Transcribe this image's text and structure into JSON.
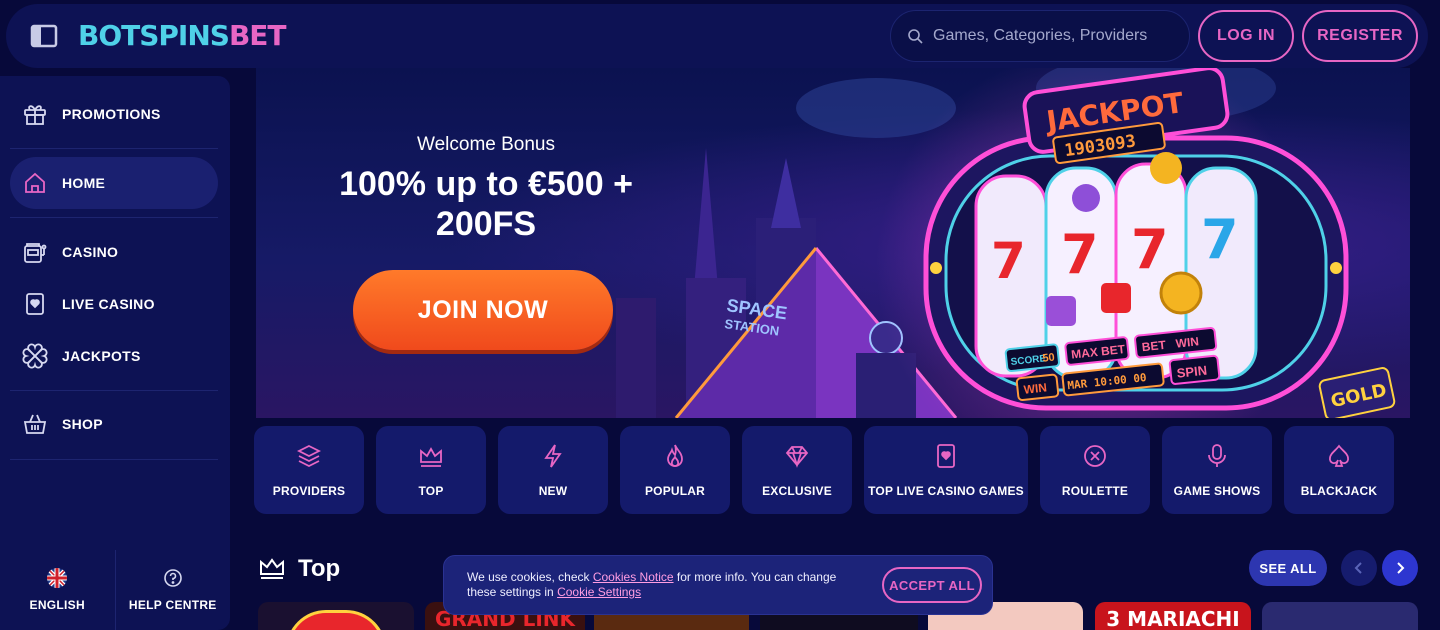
{
  "header": {
    "logo_part1": "BOTSPINS",
    "logo_part2": "BET",
    "search_placeholder": "Games, Categories, Providers",
    "login_label": "LOG IN",
    "register_label": "REGISTER"
  },
  "sidebar": {
    "items": [
      {
        "label": "PROMOTIONS",
        "icon": "gift-icon"
      },
      {
        "label": "HOME",
        "icon": "home-icon",
        "active": true
      },
      {
        "label": "CASINO",
        "icon": "slot-machine-icon"
      },
      {
        "label": "LIVE CASINO",
        "icon": "card-icon"
      },
      {
        "label": "JACKPOTS",
        "icon": "clover-icon"
      },
      {
        "label": "SHOP",
        "icon": "basket-icon"
      }
    ],
    "language_label": "ENGLISH",
    "help_label": "HELP CENTRE"
  },
  "banner": {
    "title": "Welcome Bonus",
    "amount": "100% up to €500 + 200FS",
    "cta": "JOIN NOW",
    "art_text": {
      "jackpot": "JACKPOT",
      "counter": "1903093",
      "space": "SPACE",
      "station": "STATION",
      "score": "SCORE",
      "score_value": "50",
      "max_bet": "MAX BET",
      "bet": "BET",
      "win": "WIN",
      "win2": "WIN",
      "time": "MAR 10:00 00",
      "spin": "SPIN",
      "gold": "GOLD"
    }
  },
  "categories": [
    {
      "label": "PROVIDERS",
      "icon": "layers-icon"
    },
    {
      "label": "TOP",
      "icon": "crown-icon"
    },
    {
      "label": "NEW",
      "icon": "lightning-icon"
    },
    {
      "label": "POPULAR",
      "icon": "flame-icon"
    },
    {
      "label": "EXCLUSIVE",
      "icon": "diamond-icon"
    },
    {
      "label": "TOP LIVE CASINO GAMES",
      "icon": "card-icon"
    },
    {
      "label": "ROULETTE",
      "icon": "roulette-icon"
    },
    {
      "label": "GAME SHOWS",
      "icon": "microphone-icon"
    },
    {
      "label": "BLACKJACK",
      "icon": "spade-icon"
    }
  ],
  "top_section": {
    "title": "Top",
    "see_all": "SEE ALL",
    "games": [
      {
        "label": ""
      },
      {
        "label": "GRAND LINK"
      },
      {
        "label": ""
      },
      {
        "label": ""
      },
      {
        "label": ""
      },
      {
        "label": "3 MARIACHI"
      },
      {
        "label": ""
      }
    ]
  },
  "cookie": {
    "text_before": "We use cookies, check ",
    "link1": "Cookies Notice",
    "text_middle": " for more info. You can change these settings in ",
    "link2": "Cookie Settings",
    "accept": "ACCEPT ALL"
  },
  "colors": {
    "background": "#07093a",
    "panel": "#0d1254",
    "accent_pink": "#e766c4",
    "accent_cyan": "#4fd1e8",
    "cta_orange": "#f04a1c",
    "button_blue": "#2d36b0"
  }
}
